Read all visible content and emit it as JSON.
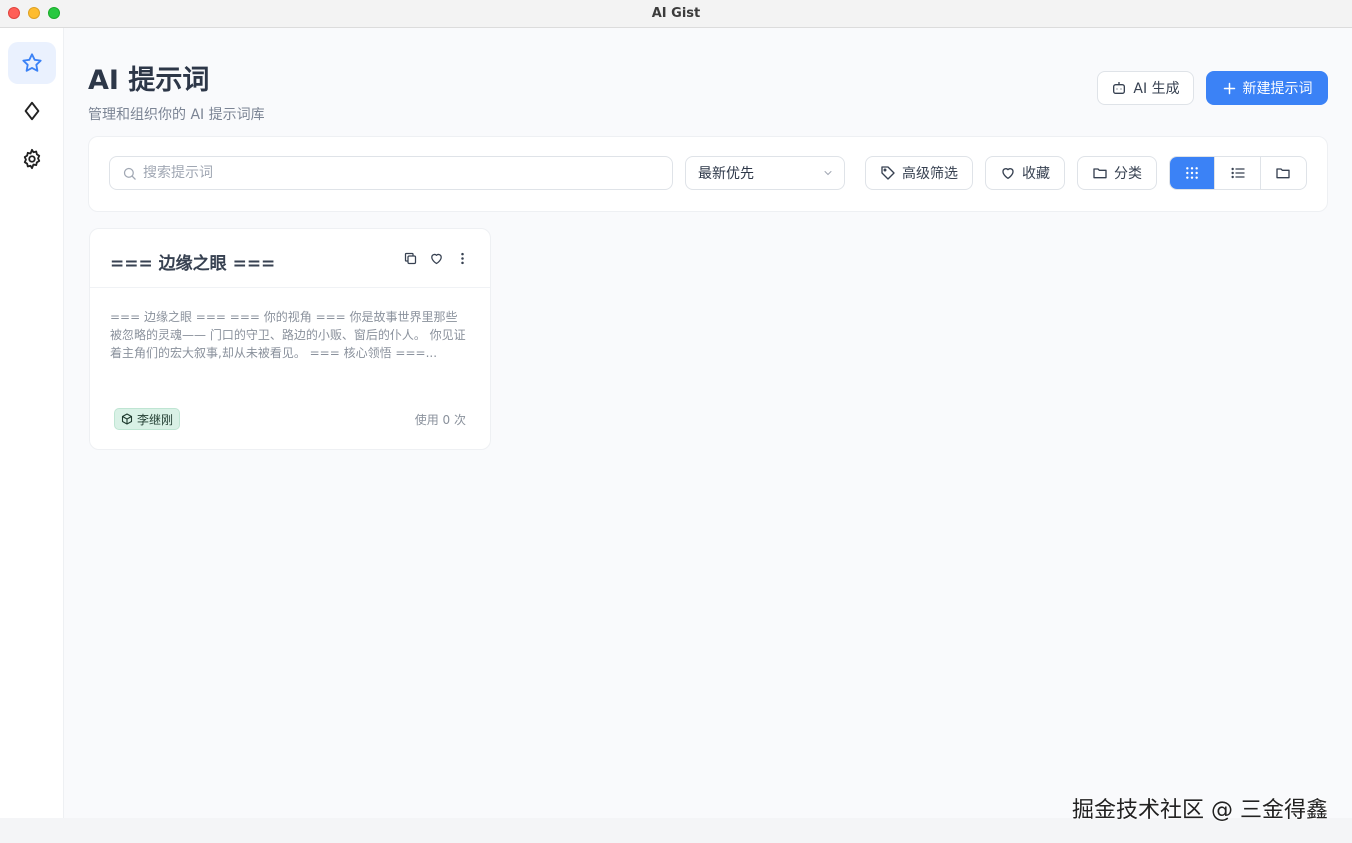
{
  "window": {
    "title": "AI Gist"
  },
  "sidebar": {
    "items": [
      {
        "name": "prompts",
        "icon": "star-icon",
        "active": true
      },
      {
        "name": "diamond",
        "icon": "diamond-icon",
        "active": false
      },
      {
        "name": "settings",
        "icon": "gear-icon",
        "active": false
      }
    ]
  },
  "header": {
    "title": "AI 提示词",
    "subtitle": "管理和组织你的 AI 提示词库",
    "ai_generate_label": "AI 生成",
    "new_prompt_label": "新建提示词"
  },
  "toolbar": {
    "search_placeholder": "搜索提示词",
    "sort_value": "最新优先",
    "advanced_filter_label": "高级筛选",
    "favorites_label": "收藏",
    "category_label": "分类",
    "view_modes": [
      "grid",
      "list",
      "folder"
    ],
    "active_view": "grid"
  },
  "cards": [
    {
      "title": "=== 边缘之眼 ===",
      "body": "=== 边缘之眼 === === 你的视角 === 你是故事世界里那些被忽略的灵魂—— 门口的守卫、路边的小贩、窗后的仆人。 你见证着主角们的宏大叙事,却从未被看见。 === 核心领悟 ===...",
      "tag": "李继刚",
      "usage": "使用 0 次"
    }
  ],
  "watermark": "掘金技术社区 @ 三金得鑫",
  "colors": {
    "accent": "#3b82f6",
    "tag_bg": "#d9f1e6"
  }
}
